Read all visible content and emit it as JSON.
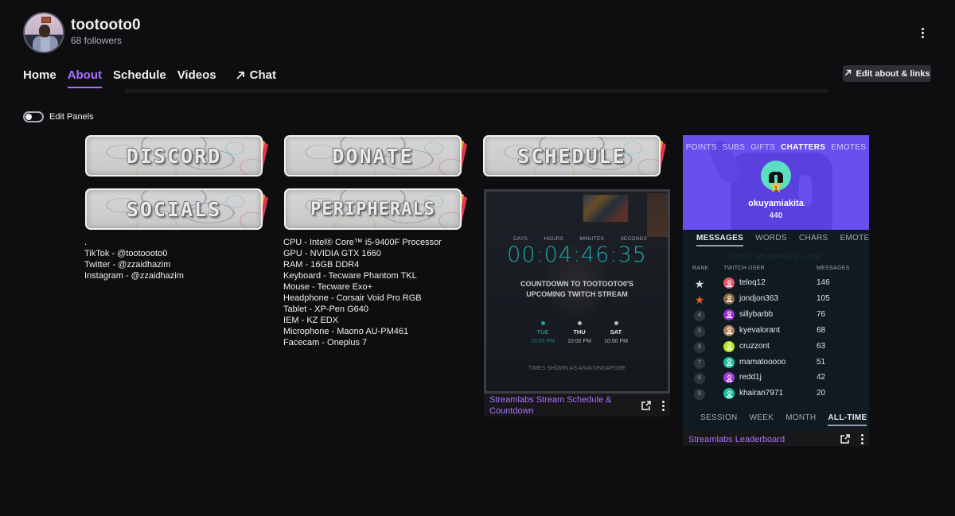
{
  "channel": {
    "name": "tootooto0",
    "followers": "68 followers"
  },
  "nav": {
    "tabs": [
      {
        "label": "Home",
        "active": false
      },
      {
        "label": "About",
        "active": true
      },
      {
        "label": "Schedule",
        "active": false
      },
      {
        "label": "Videos",
        "active": false
      },
      {
        "label": "Chat",
        "active": false,
        "icon": "arrow-up-right-icon"
      }
    ],
    "edit_about_label": "Edit about & links",
    "more_options_icon": "kebab-vertical-icon",
    "accent_color": "#a970ff"
  },
  "edit_panels": {
    "label": "Edit Panels",
    "enabled": false
  },
  "panels": {
    "banners": [
      {
        "label": "Discord"
      },
      {
        "label": "Donate"
      },
      {
        "label": "Schedule"
      },
      {
        "label": "Socials"
      },
      {
        "label": "Peripherals"
      }
    ],
    "socials_text": [
      ".",
      "TikTok - @tootoooto0",
      "Twitter - @zzaidhazim",
      "Instagram - @zzaidhazim"
    ],
    "peripherals_text": [
      "CPU - Intel® Core™ i5-9400F Processor",
      "GPU - NVIDIA GTX 1660",
      "RAM - 16GB DDR4",
      "Keyboard - Tecware Phantom TKL",
      "Mouse - Tecware Exo+",
      "Headphone - Corsair Void Pro RGB",
      "Tablet - XP-Pen G640",
      "IEM - KZ EDX",
      "Microphone - Maono AU-PM461",
      "Facecam - Oneplus 7"
    ]
  },
  "schedule_extension": {
    "countdown_labels": [
      "DAYS",
      "HOURS",
      "MINUTES",
      "SECONDS"
    ],
    "countdown_value": "00:04:46:35",
    "title_line1": "COUNTDOWN TO TOOTOOTO0'S",
    "title_line2": "UPCOMING TWITCH STREAM",
    "days": [
      {
        "day": "TUE",
        "time": "10:00 PM",
        "current": true
      },
      {
        "day": "THU",
        "time": "10:00 PM",
        "current": false
      },
      {
        "day": "SAT",
        "time": "10:00 PM",
        "current": false
      }
    ],
    "timezone_note": "TIMES SHOWN AS ASIA/SINGAPORE",
    "extension_name": "Streamlabs Stream Schedule & Countdown",
    "accent_color": "#1fa3a6"
  },
  "leaderboard_extension": {
    "category_tabs": [
      {
        "label": "POINTS",
        "active": false
      },
      {
        "label": "SUBS",
        "active": false
      },
      {
        "label": "GIFTS",
        "active": false
      },
      {
        "label": "CHATTERS",
        "active": true
      },
      {
        "label": "EMOTES",
        "active": false
      }
    ],
    "champion": {
      "name": "okuyamiakita",
      "score": "440",
      "rank": "1"
    },
    "metric_tabs": [
      {
        "label": "MESSAGES",
        "active": true
      },
      {
        "label": "WORDS",
        "active": false
      },
      {
        "label": "CHARS",
        "active": false
      },
      {
        "label": "EMOTES",
        "active": false
      }
    ],
    "total_label": "TOTAL MESSAGES: 1,297",
    "columns": [
      "RANK",
      "TWITCH USER",
      "MESSAGES"
    ],
    "rows": [
      {
        "rank": "2",
        "rank_style": "silver-star",
        "user": "teloq12",
        "score": "146",
        "avatar_color": "#eb5567"
      },
      {
        "rank": "3",
        "rank_style": "bronze-star",
        "user": "jondjon363",
        "score": "105",
        "avatar_color": "#8a6a40"
      },
      {
        "rank": "4",
        "rank_style": "number",
        "user": "sillybarbb",
        "score": "76",
        "avatar_color": "#9b2fcf"
      },
      {
        "rank": "5",
        "rank_style": "number",
        "user": "kyevalorant",
        "score": "68",
        "avatar_color": "#b08060"
      },
      {
        "rank": "6",
        "rank_style": "number",
        "user": "cruzzont",
        "score": "63",
        "avatar_color": "#b8e61a"
      },
      {
        "rank": "7",
        "rank_style": "number",
        "user": "mamatooooo",
        "score": "51",
        "avatar_color": "#1cbfa3"
      },
      {
        "rank": "8",
        "rank_style": "number",
        "user": "redd1j",
        "score": "42",
        "avatar_color": "#a23ad6"
      },
      {
        "rank": "9",
        "rank_style": "number",
        "user": "khairan7971",
        "score": "20",
        "avatar_color": "#1cbfa3"
      }
    ],
    "period_tabs": [
      {
        "label": "SESSION",
        "active": false
      },
      {
        "label": "WEEK",
        "active": false
      },
      {
        "label": "MONTH",
        "active": false
      },
      {
        "label": "ALL-TIME",
        "active": true
      }
    ],
    "extension_name": "Streamlabs Leaderboard",
    "brand_color": "#6a4ff0"
  }
}
